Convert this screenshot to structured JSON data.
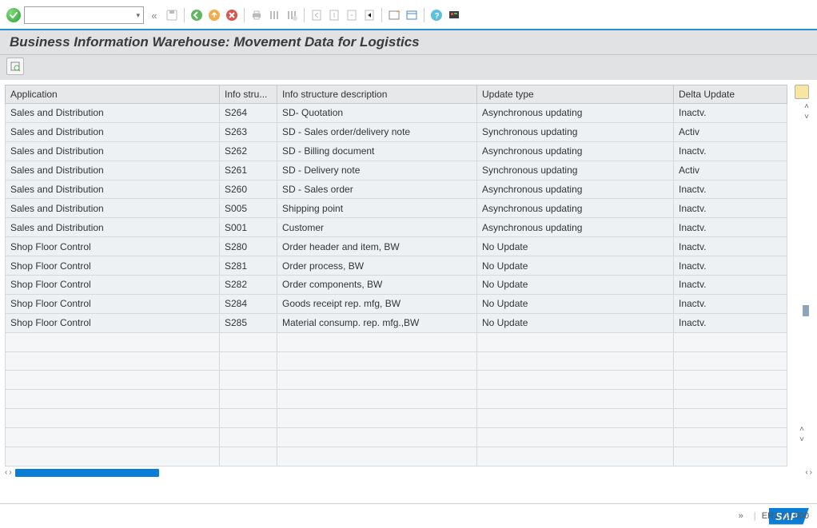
{
  "title": "Business Information Warehouse: Movement Data for Logistics",
  "toolbar": {
    "combo_value": "",
    "ok_tooltip": "Enter"
  },
  "columns": [
    "Application",
    "Info stru...",
    "Info structure description",
    "Update type",
    "Delta Update"
  ],
  "rows": [
    {
      "app": "Sales and Distribution",
      "code": "S264",
      "desc": "SD- Quotation",
      "upd": "Asynchronous updating",
      "delta": "Inactv."
    },
    {
      "app": "Sales and Distribution",
      "code": "S263",
      "desc": "SD - Sales order/delivery note",
      "upd": "Synchronous updating",
      "delta": "Activ",
      "selected": true
    },
    {
      "app": "Sales and Distribution",
      "code": "S262",
      "desc": "SD - Billing document",
      "upd": "Asynchronous updating",
      "delta": "Inactv."
    },
    {
      "app": "Sales and Distribution",
      "code": "S261",
      "desc": "SD - Delivery note",
      "upd": "Synchronous updating",
      "delta": "Activ"
    },
    {
      "app": "Sales and Distribution",
      "code": "S260",
      "desc": "SD - Sales order",
      "upd": "Asynchronous updating",
      "delta": "Inactv."
    },
    {
      "app": "Sales and Distribution",
      "code": "S005",
      "desc": "Shipping point",
      "upd": "Asynchronous updating",
      "delta": "Inactv."
    },
    {
      "app": "Sales and Distribution",
      "code": "S001",
      "desc": "Customer",
      "upd": "Asynchronous updating",
      "delta": "Inactv."
    },
    {
      "app": "Shop Floor Control",
      "code": "S280",
      "desc": "Order header and item, BW",
      "upd": "No Update",
      "delta": "Inactv."
    },
    {
      "app": "Shop Floor Control",
      "code": "S281",
      "desc": "Order process, BW",
      "upd": "No Update",
      "delta": "Inactv."
    },
    {
      "app": "Shop Floor Control",
      "code": "S282",
      "desc": "Order components, BW",
      "upd": "No Update",
      "delta": "Inactv."
    },
    {
      "app": "Shop Floor Control",
      "code": "S284",
      "desc": "Goods receipt rep. mfg, BW",
      "upd": "No Update",
      "delta": "Inactv."
    },
    {
      "app": "Shop Floor Control",
      "code": "S285",
      "desc": "Material consump. rep. mfg.,BW",
      "upd": "No Update",
      "delta": "Inactv."
    }
  ],
  "empty_rows": 7,
  "status": {
    "system": "ER1 (1) 800"
  },
  "logo": "SAP"
}
